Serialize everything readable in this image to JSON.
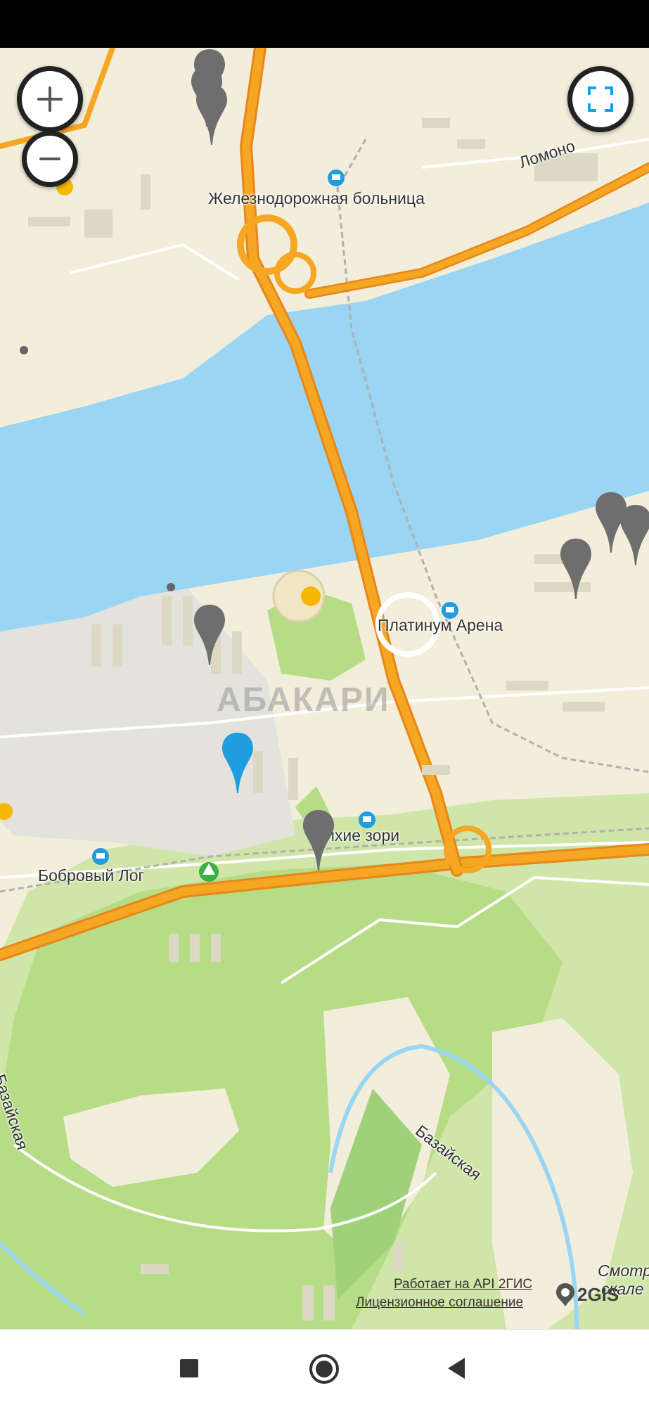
{
  "map": {
    "labels": {
      "hospital": "Железнодорожная больница",
      "lomonosov": "Ломоно",
      "arena": "Платинум Арена",
      "zori": "ихие зори",
      "bobrovy": "Бобровый Лог",
      "bazaiskaya1": "Базайская",
      "bazaiskaya2": "Базайская",
      "smotr": "Смотр",
      "skale": "скале"
    },
    "watermark": "АБАКАРИ",
    "attribution": {
      "api": "Работает на API 2ГИС",
      "license": "Лицензионное соглашение",
      "logo": "2GIS"
    },
    "colors": {
      "water": "#9ad6f3",
      "road": "#f5a623",
      "park": "#b6dc86",
      "pin_gray": "#6e6e6e",
      "pin_blue": "#1e9ee0"
    }
  }
}
